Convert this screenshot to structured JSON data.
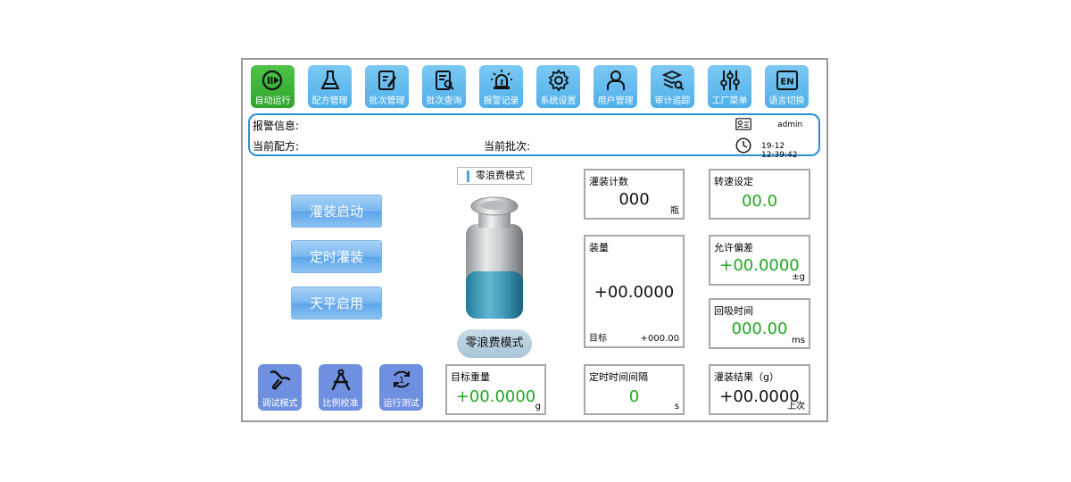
{
  "nav": [
    {
      "label": "自动运行",
      "icon": "auto-run-icon",
      "active": true
    },
    {
      "label": "配方管理",
      "icon": "flask-icon",
      "active": false
    },
    {
      "label": "批次管理",
      "icon": "edit-document-icon",
      "active": false
    },
    {
      "label": "批次查询",
      "icon": "document-search-icon",
      "active": false
    },
    {
      "label": "报警记录",
      "icon": "alarm-light-icon",
      "active": false
    },
    {
      "label": "系统设置",
      "icon": "gear-icon",
      "active": false
    },
    {
      "label": "用户管理",
      "icon": "user-icon",
      "active": false
    },
    {
      "label": "审计追踪",
      "icon": "stack-search-icon",
      "active": false
    },
    {
      "label": "工厂菜单",
      "icon": "sliders-icon",
      "active": false
    },
    {
      "label": "语言切换",
      "icon": "language-en-icon",
      "active": false
    }
  ],
  "language_badge": "EN",
  "info": {
    "alarm_label": "报警信息:",
    "recipe_label": "当前配方:",
    "batch_label": "当前批次:",
    "user": "admin",
    "time": "19-12 12:39:42"
  },
  "actions": {
    "fill_start": "灌装启动",
    "timed_fill": "定时灌装",
    "balance_enable": "天平启用"
  },
  "tools": [
    {
      "label": "调试模式",
      "icon": "wrench-icon"
    },
    {
      "label": "比例校准",
      "icon": "compass-icon"
    },
    {
      "label": "运行测试",
      "icon": "cycle-one-icon"
    }
  ],
  "mode": {
    "tag": "零浪费模式",
    "pill": "零浪费模式"
  },
  "target_weight": {
    "title": "目标重量",
    "value": "+00.0000",
    "unit": "g"
  },
  "fill_count": {
    "title": "灌装计数",
    "value": "000",
    "unit": "瓶"
  },
  "fill_amount": {
    "title": "装量",
    "value": "+00.0000",
    "target_label": "目标",
    "target_value": "+000.00"
  },
  "timed_interval": {
    "title": "定时时间间隔",
    "value": "0",
    "unit": "s"
  },
  "speed": {
    "title": "转速设定",
    "value": "00.0"
  },
  "tolerance": {
    "title": "允许偏差",
    "value": "+00.0000",
    "unit": "±g"
  },
  "suck_back": {
    "title": "回吸时间",
    "value": "000.00",
    "unit": "ms"
  },
  "fill_result": {
    "title": "灌装结果（g）",
    "value": "+00.0000",
    "unit": "上次"
  },
  "bottle": {
    "fill_level": 0.5
  },
  "colors": {
    "accent": "#4fb0ea",
    "active": "#2fa52b",
    "tool": "#6f8fe0",
    "value_green": "#1fa81f",
    "border_blue": "#2b8fd6"
  }
}
